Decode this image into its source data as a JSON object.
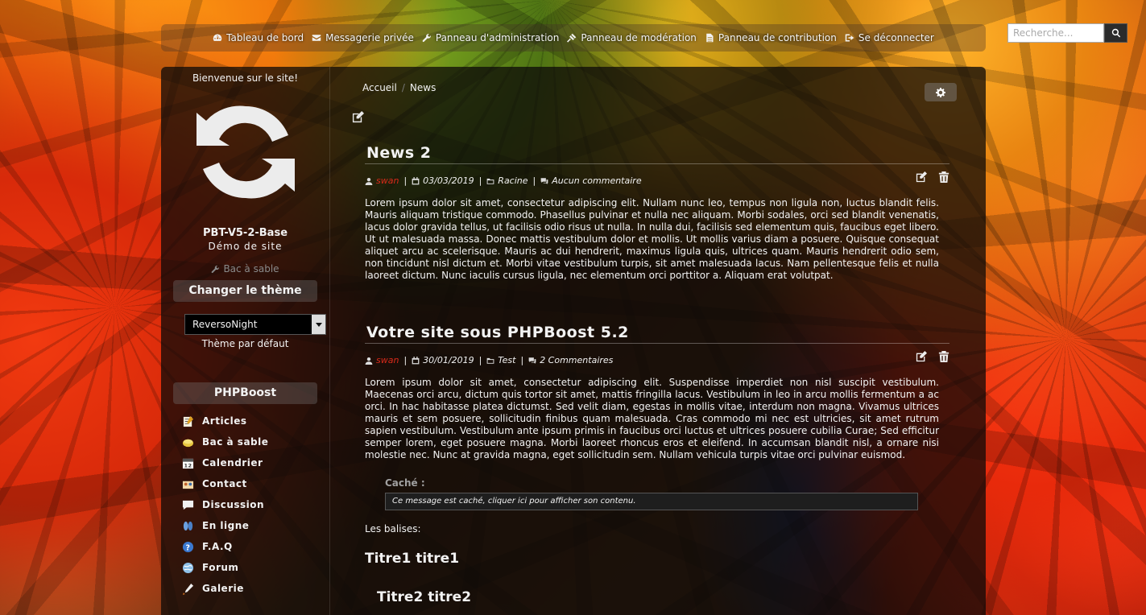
{
  "topnav": {
    "items": [
      {
        "label": "Tableau de bord",
        "icon": "dashboard-icon"
      },
      {
        "label": "Messagerie privée",
        "icon": "envelope-icon"
      },
      {
        "label": "Panneau d'administration",
        "icon": "wrench-icon"
      },
      {
        "label": "Panneau de modération",
        "icon": "gavel-icon"
      },
      {
        "label": "Panneau de contribution",
        "icon": "file-icon"
      },
      {
        "label": "Se déconnecter",
        "icon": "sign-out-icon"
      }
    ]
  },
  "search": {
    "placeholder": "Recherche..."
  },
  "sidebar": {
    "welcome": "Bienvenue sur le site!",
    "site_name": "PBT-V5-2-Base",
    "slogan": "Démo de site",
    "sandbox_link": "Bac à sable",
    "theme_box": {
      "title": "Changer le thème",
      "selected": "ReversoNight",
      "default_link": "Thème par défaut"
    },
    "menu": {
      "title": "PHPBoost",
      "items": [
        {
          "label": "Articles",
          "icon": "articles-icon"
        },
        {
          "label": "Bac à sable",
          "icon": "sandbox-icon"
        },
        {
          "label": "Calendrier",
          "icon": "calendar-icon"
        },
        {
          "label": "Contact",
          "icon": "contact-icon"
        },
        {
          "label": "Discussion",
          "icon": "discussion-icon"
        },
        {
          "label": "En ligne",
          "icon": "online-icon"
        },
        {
          "label": "F.A.Q",
          "icon": "faq-icon"
        },
        {
          "label": "Forum",
          "icon": "forum-icon"
        },
        {
          "label": "Galerie",
          "icon": "gallery-icon"
        }
      ]
    }
  },
  "breadcrumb": {
    "home": "Accueil",
    "current": "News",
    "separator": "/"
  },
  "articles": [
    {
      "title": "News 2",
      "author": "swan",
      "date": "03/03/2019",
      "category": "Racine",
      "comments": "Aucun commentaire",
      "body": "Lorem ipsum dolor sit amet, consectetur adipiscing elit. Nullam nunc leo, tempus non ligula non, luctus blandit felis. Mauris aliquam tristique commodo. Phasellus pulvinar et nulla nec aliquam. Morbi sodales, orci sed blandit venenatis, lacus dolor gravida tellus, ut facilisis odio risus ut nulla. In nulla dui, facilisis sed elementum quis, faucibus eget libero. Ut ut malesuada massa. Donec mattis vestibulum dolor et mollis. Ut mollis varius diam a posuere. Quisque consequat aliquet arcu ac scelerisque. Mauris ac dui hendrerit, maximus ligula quis, ultrices quam. Mauris hendrerit odio sem, non tincidunt nisl dictum et. Morbi vitae vestibulum turpis, sit amet malesuada lacus. Nam pellentesque felis et nulla laoreet dictum. Nunc iaculis cursus ligula, nec elementum orci porttitor a. Aliquam erat volutpat."
    },
    {
      "title": "Votre site sous PHPBoost 5.2",
      "author": "swan",
      "date": "30/01/2019",
      "category": "Test",
      "comments": "2 Commentaires",
      "body": "Lorem ipsum dolor sit amet, consectetur adipiscing elit. Suspendisse imperdiet non nisl suscipit vestibulum. Maecenas orci arcu, dictum quis tortor sit amet, mattis fringilla lacus. Vestibulum in leo in arcu mollis fermentum a ac orci. In hac habitasse platea dictumst. Sed velit diam, egestas in mollis vitae, interdum non magna. Vivamus ultrices mauris et sem posuere, sollicitudin finibus quam malesuada. Cras commodo mi nec est ultricies, sit amet rutrum sapien vestibulum. Vestibulum ante ipsum primis in faucibus orci luctus et ultrices posuere cubilia Curae; Sed efficitur semper lorem, eget posuere magna. Morbi laoreet rhoncus eros et eleifend. In accumsan blandit nisl, a ornare nisi molestie nec. Nunc at gravida magna, eget sollicitudin sem. Nullam vehicula turpis vitae orci pulvinar euismod.",
      "hidden_label": "Caché :",
      "hidden_text": "Ce message est caché, cliquer ici pour afficher son contenu.",
      "tags_label": "Les balises:",
      "h1": "Titre1 titre1",
      "h2": "Titre2 titre2"
    }
  ],
  "colors": {
    "author": "#d92a1a",
    "panel_bg": "#0c0a08"
  }
}
